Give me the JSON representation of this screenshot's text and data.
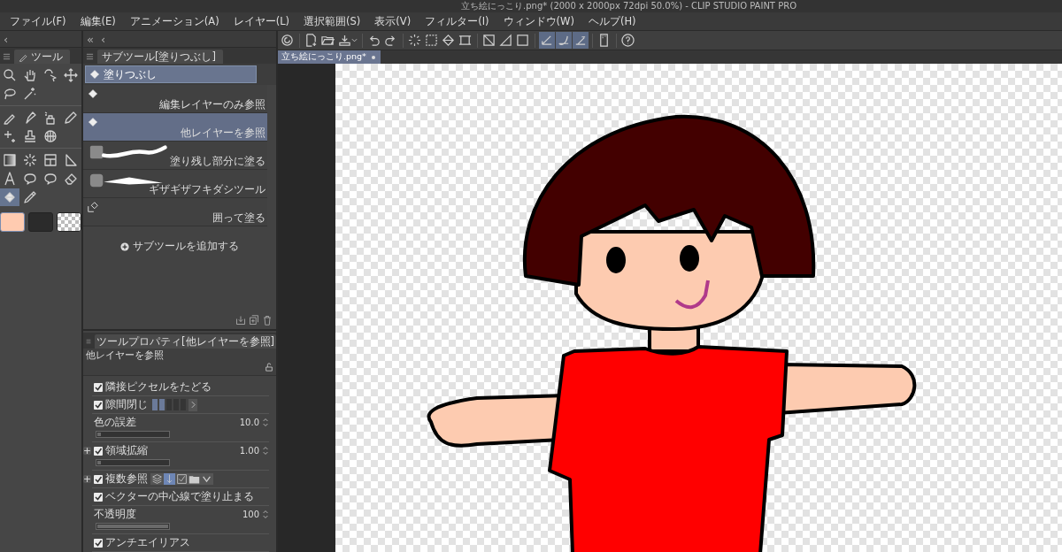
{
  "window": {
    "title": "立ち絵にっこり.png* (2000 x 2000px 72dpi 50.0%)  - CLIP STUDIO PAINT PRO"
  },
  "menu": [
    "ファイル(F)",
    "編集(E)",
    "アニメーション(A)",
    "レイヤー(L)",
    "選択範囲(S)",
    "表示(V)",
    "フィルター(I)",
    "ウィンドウ(W)",
    "ヘルプ(H)"
  ],
  "toolbar": [
    {
      "kind": "companion",
      "selected": false
    },
    {
      "kind": "new",
      "selected": false
    },
    {
      "kind": "open",
      "selected": false
    },
    {
      "kind": "export",
      "selected": false
    },
    {
      "kind": "undo",
      "selected": false
    },
    {
      "kind": "redo",
      "selected": false
    },
    {
      "kind": "select",
      "selected": false
    },
    {
      "kind": "deselect",
      "selected": false
    },
    {
      "kind": "fillsel",
      "selected": false
    },
    {
      "kind": "transform",
      "selected": false
    },
    {
      "kind": "clearout",
      "selected": false
    },
    {
      "kind": "clear",
      "selected": false
    },
    {
      "kind": "frame",
      "selected": false
    },
    {
      "kind": "snapruler",
      "selected": true
    },
    {
      "kind": "snapspecial",
      "selected": true
    },
    {
      "kind": "snapgrid",
      "selected": true
    },
    {
      "kind": "device",
      "selected": false
    },
    {
      "kind": "help",
      "selected": false
    }
  ],
  "tool_panel": {
    "back": "‹",
    "tab": "ツール",
    "groups": [
      [
        {
          "kind": "zoom",
          "selected": false
        },
        {
          "kind": "hand",
          "selected": false
        },
        {
          "kind": "object",
          "selected": false
        },
        {
          "kind": "move",
          "selected": false
        },
        {
          "kind": "lasso",
          "selected": false
        },
        {
          "kind": "wand",
          "selected": false
        }
      ],
      [
        {
          "kind": "pen",
          "selected": false
        },
        {
          "kind": "pen2",
          "selected": false
        },
        {
          "kind": "airbrush",
          "selected": false
        },
        {
          "kind": "pencil",
          "selected": false
        },
        {
          "kind": "decoration",
          "selected": false
        },
        {
          "kind": "stamp",
          "selected": false
        },
        {
          "kind": "globe",
          "selected": false
        }
      ],
      [
        {
          "kind": "gradient",
          "selected": false
        },
        {
          "kind": "burst",
          "selected": false
        },
        {
          "kind": "panel",
          "selected": false
        },
        {
          "kind": "ruler",
          "selected": false
        },
        {
          "kind": "text",
          "selected": false
        },
        {
          "kind": "balloon",
          "selected": false
        },
        {
          "kind": "balloon",
          "selected": false
        },
        {
          "kind": "eraser",
          "selected": false
        },
        {
          "kind": "fill",
          "selected": true
        },
        {
          "kind": "eyedropper",
          "selected": false
        }
      ]
    ],
    "swatches": [
      {
        "kind": "color",
        "color": "#ffcbb0",
        "selected": true
      },
      {
        "kind": "color",
        "color": "#2b2b2b",
        "selected": false
      },
      {
        "kind": "transparent",
        "selected": false
      }
    ]
  },
  "subtool_panel": {
    "collapse": "«",
    "back": "‹",
    "tab": "サブツール[塗りつぶし]",
    "group_tab": "塗りつぶし",
    "items": [
      {
        "label": "編集レイヤーのみ参照",
        "kind": "fill",
        "selected": false
      },
      {
        "label": "他レイヤーを参照",
        "kind": "fill",
        "selected": true
      },
      {
        "label": "塗り残し部分に塗る",
        "kind": "stroke",
        "selected": false
      },
      {
        "label": "ギザギザフキダシツール",
        "kind": "spike",
        "selected": false
      },
      {
        "label": "囲って塗る",
        "kind": "fillsub",
        "selected": false
      }
    ],
    "add_button": "サブツールを追加する"
  },
  "property_panel": {
    "tab": "ツールプロパティ[他レイヤーを参照]",
    "preset": "他レイヤーを参照",
    "rows": [
      {
        "kind": "check",
        "label": "隣接ピクセルをたどる",
        "checked": true
      },
      {
        "kind": "gap",
        "label": "隙間閉じ",
        "checked": true,
        "level": 0.4
      },
      {
        "kind": "slider",
        "label": "色の誤差",
        "value": "10.0",
        "level": 0.05
      },
      {
        "kind": "slider",
        "label": "領域拡縮",
        "value": "1.00",
        "level": 0.05,
        "checked": true,
        "expandable": true
      },
      {
        "kind": "refer",
        "label": "複数参照",
        "checked": true,
        "expandable": true
      },
      {
        "kind": "check",
        "label": "ベクターの中心線で塗り止まる",
        "checked": true
      },
      {
        "kind": "slider",
        "label": "不透明度",
        "value": "100",
        "level": 1
      },
      {
        "kind": "check",
        "label": "アンチエイリアス",
        "checked": true
      }
    ]
  },
  "document": {
    "tab": "立ち絵にっこり.png*",
    "modified": true
  }
}
